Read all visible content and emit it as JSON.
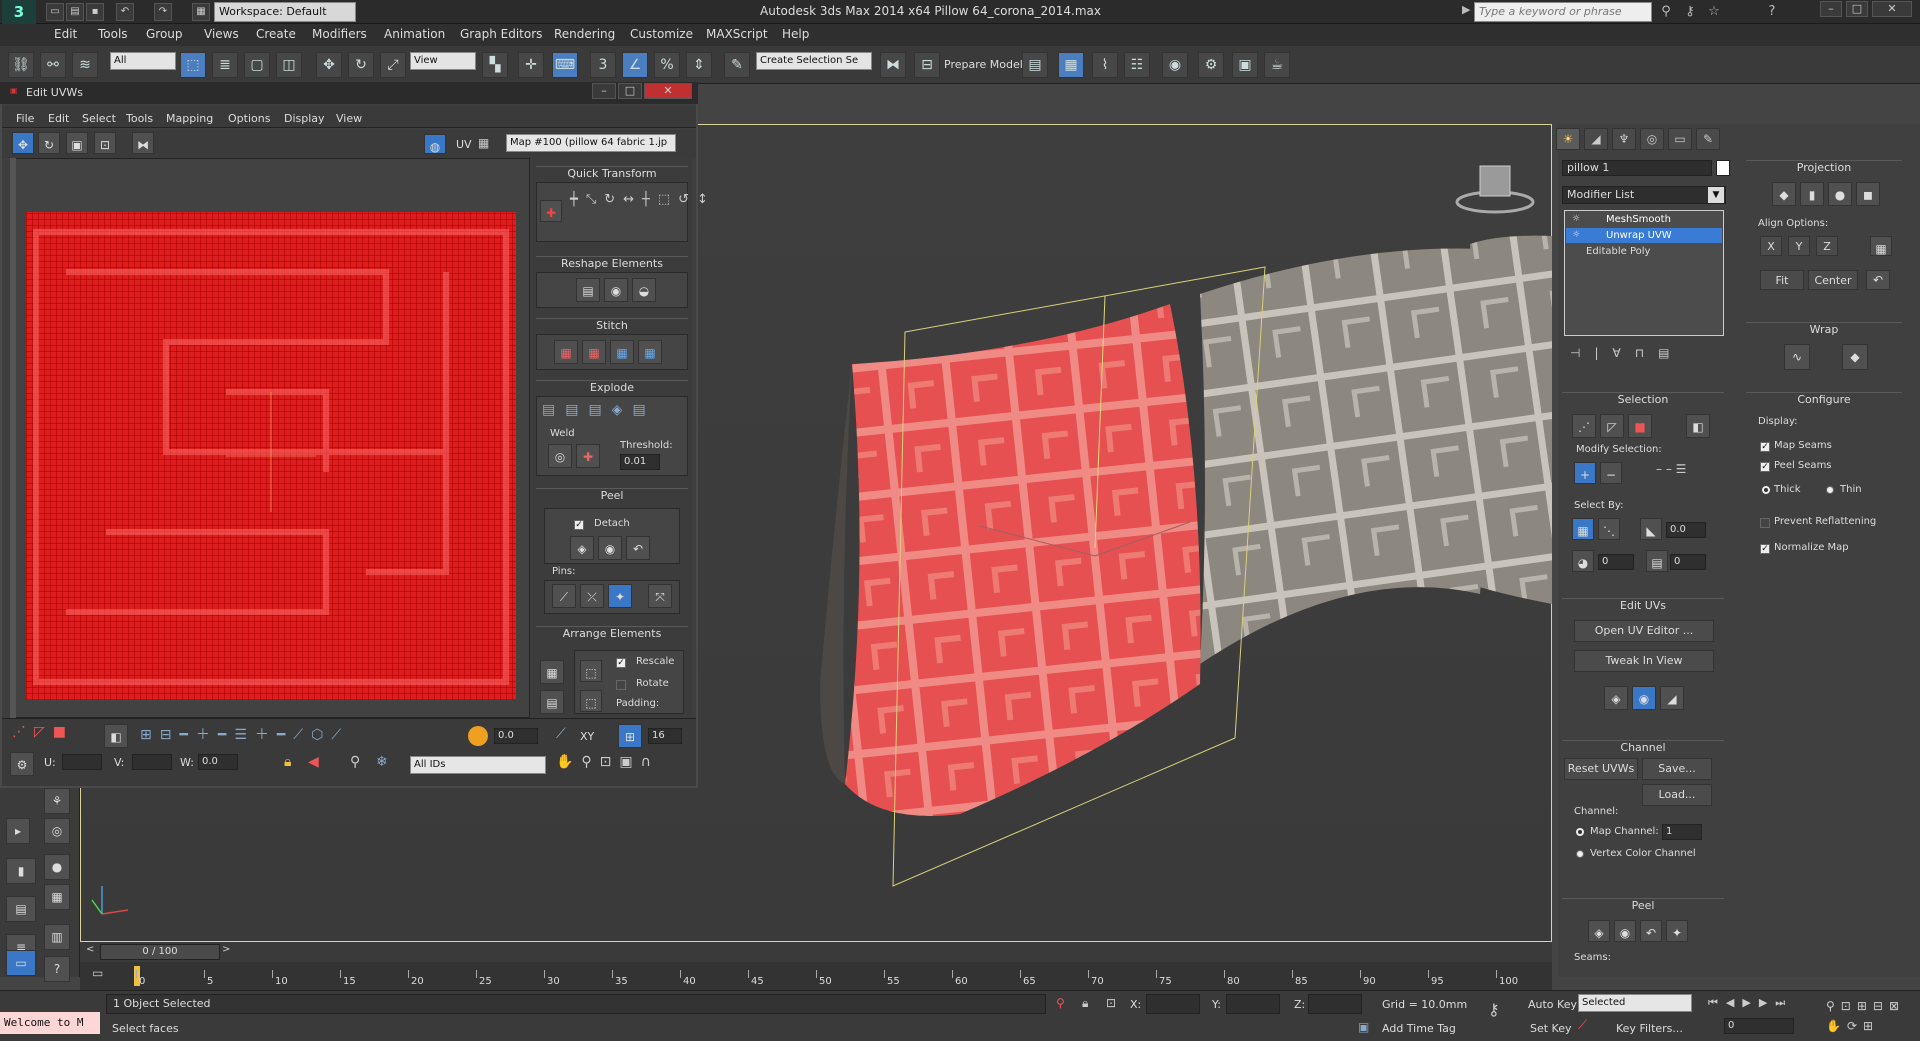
{
  "app": {
    "title": "Autodesk 3ds Max  2014 x64     Pillow 64_corona_2014.max",
    "workspace": "Workspace: Default",
    "search_placeholder": "Type a keyword or phrase"
  },
  "menu": [
    "Edit",
    "Tools",
    "Group",
    "Views",
    "Create",
    "Modifiers",
    "Animation",
    "Graph Editors",
    "Rendering",
    "Customize",
    "MAXScript",
    "Help"
  ],
  "toolbar": {
    "filter": "All",
    "refcoord": "View",
    "selection_set": "Create Selection Se",
    "prepare": "Prepare Model"
  },
  "uv": {
    "title": "Edit UVWs",
    "menu": [
      "File",
      "Edit",
      "Select",
      "Tools",
      "Mapping",
      "Options",
      "Display",
      "View"
    ],
    "uv_label": "UV",
    "map_select": "Map #100 (pillow 64 fabric 1.jp",
    "quick_transform": "Quick Transform",
    "reshape": "Reshape Elements",
    "stitch": "Stitch",
    "explode": "Explode",
    "weld": "Weld",
    "threshold_label": "Threshold:",
    "threshold": "0.01",
    "peel": "Peel",
    "detach": "Detach",
    "pins": "Pins:",
    "arrange": "Arrange Elements",
    "rescale": "Rescale",
    "rotate": "Rotate",
    "padding": "Padding:",
    "spin_value": "0.0",
    "count": "16",
    "xy": "XY",
    "u_label": "U:",
    "v_label": "V:",
    "w_label": "W:",
    "w_value": "0.0",
    "ids": "All IDs"
  },
  "cmd": {
    "object_name": "pillow 1",
    "modifier_list": "Modifier List",
    "stack": [
      "MeshSmooth",
      "Unwrap UVW",
      "Editable Poly"
    ],
    "selection": "Selection",
    "modify_selection": "Modify Selection:",
    "select_by": "Select By:",
    "angle": "0.0",
    "sel_a": "0",
    "sel_b": "0",
    "edit_uvs": "Edit UVs",
    "open_uv_editor": "Open UV Editor ...",
    "tweak_in_view": "Tweak In View",
    "channel": "Channel",
    "reset_uvws": "Reset UVWs",
    "save": "Save...",
    "load": "Load...",
    "channel_label": "Channel:",
    "map_channel": "Map Channel:",
    "map_channel_value": "1",
    "vertex_color": "Vertex Color Channel",
    "peel": "Peel",
    "seams": "Seams:",
    "projection": "Projection",
    "align_options": "Align Options:",
    "fit": "Fit",
    "center": "Center",
    "x": "X",
    "y": "Y",
    "z": "Z",
    "wrap": "Wrap",
    "configure": "Configure",
    "display": "Display:",
    "map_seams": "Map Seams",
    "peel_seams": "Peel Seams",
    "thick": "Thick",
    "thin": "Thin",
    "prevent": "Prevent Reflattening",
    "normalize": "Normalize Map"
  },
  "timeline": {
    "slider": "0 / 100",
    "ticks": [
      "0",
      "5",
      "10",
      "15",
      "20",
      "25",
      "30",
      "35",
      "40",
      "45",
      "50",
      "55",
      "60",
      "65",
      "70",
      "75",
      "80",
      "85",
      "90",
      "95",
      "100"
    ]
  },
  "status": {
    "welcome": "Welcome to M",
    "objects": "1 Object Selected",
    "prompt": "Select faces",
    "x": "X:",
    "y": "Y:",
    "z": "Z:",
    "grid": "Grid = 10.0mm",
    "add_time_tag": "Add Time Tag",
    "auto_key": "Auto Key",
    "set_key": "Set Key",
    "selected": "Selected",
    "key_filters": "Key Filters...",
    "frame": "0"
  }
}
